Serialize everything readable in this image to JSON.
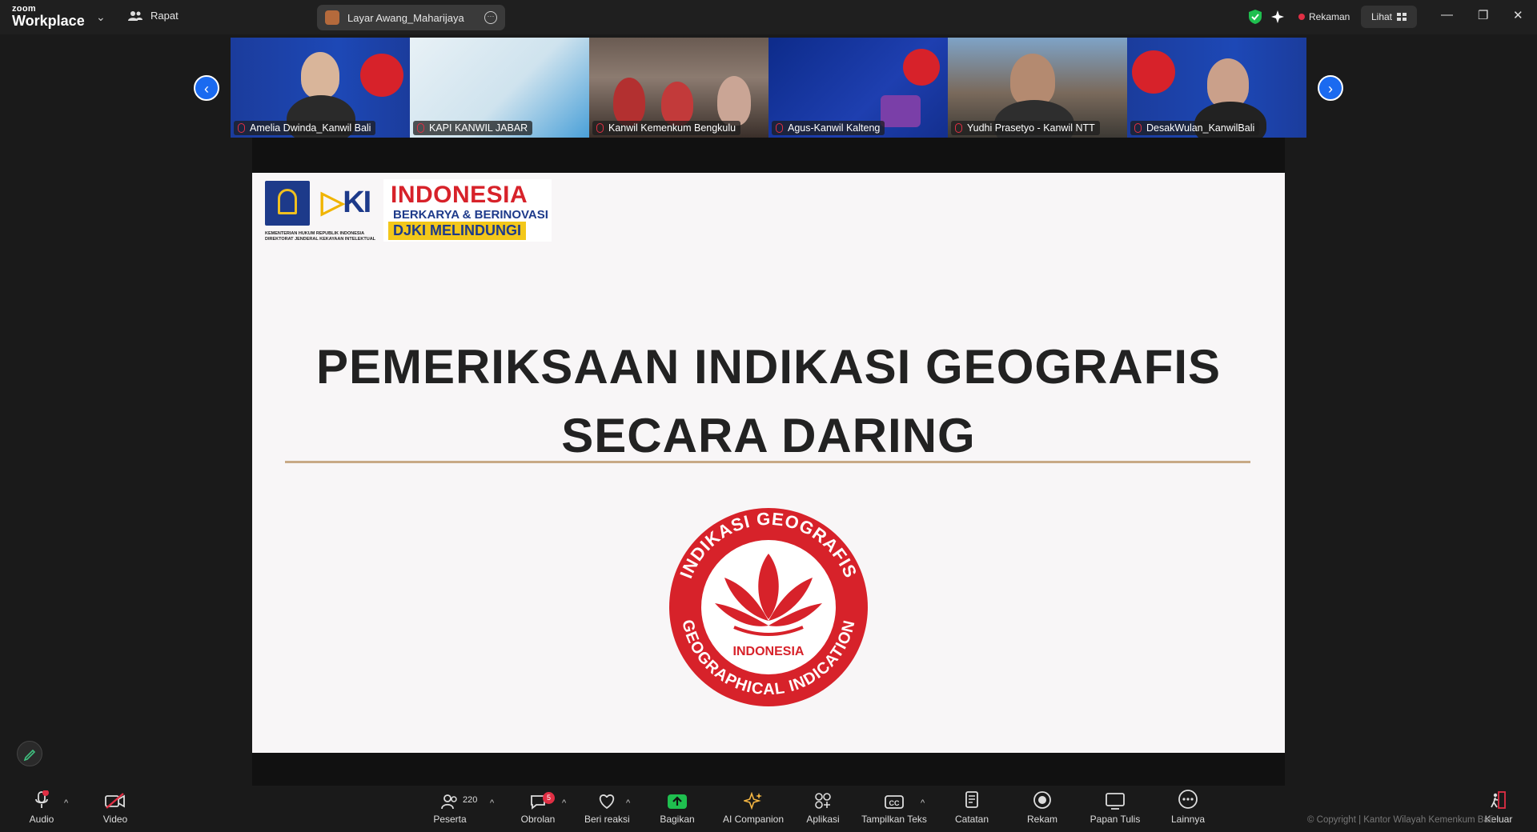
{
  "app": {
    "brand_small": "zoom",
    "brand_large": "Workplace",
    "meeting_label": "Rapat",
    "share_label": "Layar Awang_Maharijaya",
    "recording_label": "Rekaman",
    "view_label": "Lihat"
  },
  "colors": {
    "accent_blue": "#1a6af0",
    "record_red": "#e02f44",
    "share_green": "#1fbf4f",
    "slide_title": "#222222",
    "seal_red": "#d7222a"
  },
  "participants": [
    {
      "name": "Amelia Dwinda_Kanwil Bali",
      "muted": true
    },
    {
      "name": "KAPI KANWIL JABAR",
      "muted": true
    },
    {
      "name": "Kanwil Kemenkum Bengkulu",
      "muted": true
    },
    {
      "name": "Agus-Kanwil Kalteng",
      "muted": true
    },
    {
      "name": "Yudhi Prasetyo - Kanwil NTT",
      "muted": true
    },
    {
      "name": "DesakWulan_KanwilBali",
      "muted": true
    }
  ],
  "slide": {
    "ministry_caption_1": "KEMENTERIAN HUKUM REPUBLIK INDONESIA",
    "ministry_caption_2": "DIREKTORAT JENDERAL KEKAYAAN INTELEKTUAL",
    "banner_line1": "INDONESIA",
    "banner_line2": "BERKARYA & BERINOVASI",
    "banner_line3": "DJKI MELINDUNGI",
    "title_line1": "PEMERIKSAAN INDIKASI GEOGRAFIS",
    "title_line2": "SECARA DARING",
    "seal_top": "INDIKASI GEOGRAFIS",
    "seal_middle": "INDONESIA",
    "seal_bottom": "GEOGRAPHICAL INDICATION"
  },
  "toolbar": {
    "audio": "Audio",
    "video": "Video",
    "participants": "Peserta",
    "participants_count": "220",
    "chat": "Obrolan",
    "chat_badge": "5",
    "react": "Beri reaksi",
    "share": "Bagikan",
    "ai": "AI Companion",
    "apps": "Aplikasi",
    "captions": "Tampilkan Teks",
    "notes": "Catatan",
    "record": "Rekam",
    "whiteboard": "Papan Tulis",
    "more": "Lainnya",
    "leave": "Keluar"
  },
  "watermark": "© Copyright | Kantor Wilayah Kemenkum Bali"
}
